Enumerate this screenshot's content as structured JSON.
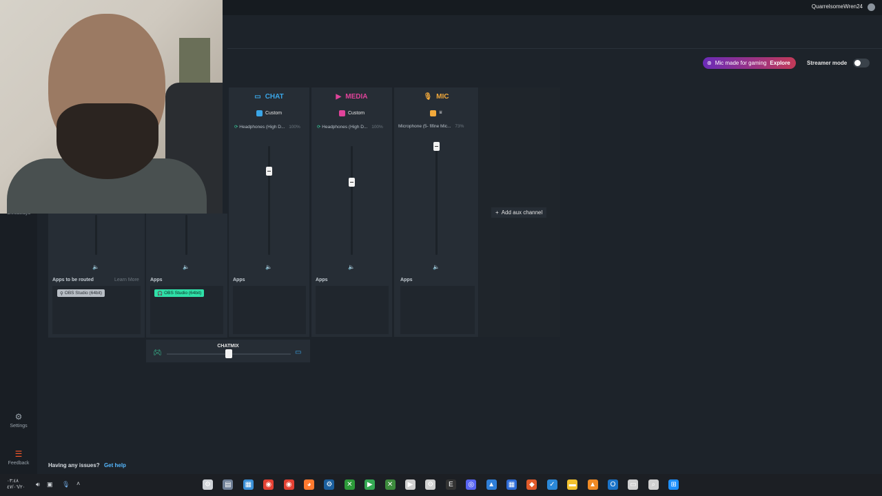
{
  "topbar": {
    "username": "QuarrelsomeWren24"
  },
  "sidebar": {
    "partial_label": "Giveaways",
    "settings_label": "Settings",
    "feedback_label": "Feedback"
  },
  "promo": {
    "text": "Mic made for gaming",
    "explore": "Explore"
  },
  "streamer_mode": {
    "label": "Streamer mode",
    "on": false
  },
  "channels": [
    {
      "name": "CHAT",
      "color": "#3aa6e8",
      "preset": "Custom",
      "preset_color": "#3aa6e8",
      "device": "Headphones (High D...",
      "volume_pct": "100%",
      "fader_level": 0.75
    },
    {
      "name": "MEDIA",
      "color": "#e0439a",
      "preset": "Custom",
      "preset_color": "#e0439a",
      "device": "Headphones (High D...",
      "volume_pct": "100%",
      "fader_level": 0.64
    },
    {
      "name": "MIC",
      "color": "#f2a93b",
      "preset": "",
      "preset_color": "#f2a93b",
      "device": "Microphone (5- fifine Mic...",
      "volume_pct": "73%",
      "fader_level": 1.0
    }
  ],
  "apps_sections": [
    {
      "label": "Apps to be routed",
      "link": "Learn More",
      "chip": "OBS Studio (64bit)"
    },
    {
      "label": "Apps",
      "chip": "OBS Studio (64bit)"
    },
    {
      "label": "Apps"
    },
    {
      "label": "Apps"
    },
    {
      "label": "Apps"
    }
  ],
  "add_aux": {
    "label": "Add aux channel"
  },
  "chatmix": {
    "label": "CHATMIX",
    "balance": 0.5
  },
  "footer": {
    "issues": "Having any issues?",
    "help": "Get help"
  },
  "tray": {
    "time": "۰۳:٤٨",
    "date": "٤٧/۰٦/٢٠"
  },
  "taskbar_icons": [
    "sonar-icon",
    "file-icon",
    "notepad-icon",
    "chrome-icon",
    "chrome-icon",
    "firefox-icon",
    "steam-icon",
    "xbox-icon",
    "gplay-icon",
    "xbox-app-icon",
    "media-icon",
    "steelseries-icon",
    "epic-icon",
    "discord-icon",
    "photos-icon",
    "store-icon",
    "office-icon",
    "todo-icon",
    "folder-icon",
    "aimp-icon",
    "outlook-icon",
    "taskview-icon",
    "search-icon",
    "start-icon"
  ]
}
